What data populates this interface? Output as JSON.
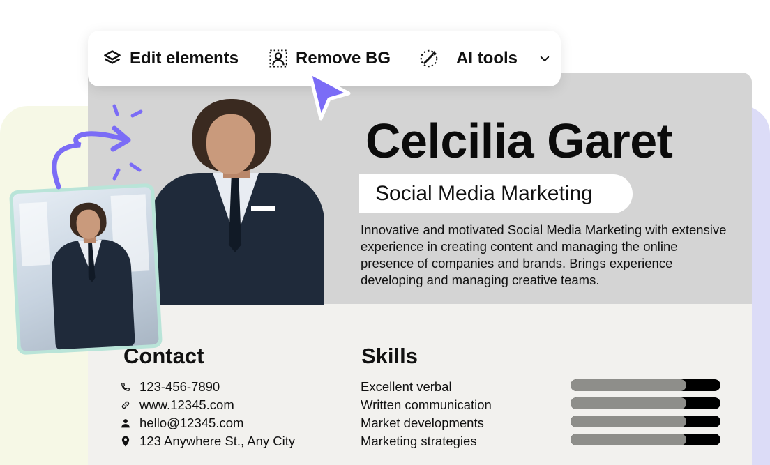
{
  "toolbar": {
    "items": [
      {
        "label": "Edit elements",
        "icon": "layers-icon"
      },
      {
        "label": "Remove BG",
        "icon": "person-remove-bg-icon"
      },
      {
        "label": "AI tools",
        "icon": "magic-wand-icon"
      }
    ],
    "dropdown_icon": "chevron-down-icon"
  },
  "resume": {
    "name": "Celcilia Garet",
    "role": "Social Media Marketing",
    "summary": "Innovative and motivated Social Media Marketing with extensive experience in creating content and managing the online presence of companies and brands. Brings experience developing and managing creative teams.",
    "contact_title": "Contact",
    "contact": [
      {
        "icon": "phone-icon",
        "text": "123-456-7890"
      },
      {
        "icon": "link-icon",
        "text": "www.12345.com"
      },
      {
        "icon": "user-icon",
        "text": "hello@12345.com"
      },
      {
        "icon": "location-pin-icon",
        "text": "123 Anywhere St., Any City"
      }
    ],
    "skills_title": "Skills",
    "skills": [
      {
        "label": "Excellent verbal",
        "level": 0.77
      },
      {
        "label": "Written communication",
        "level": 0.77
      },
      {
        "label": "Market developments",
        "level": 0.77
      },
      {
        "label": "Marketing strategies",
        "level": 0.77
      }
    ]
  },
  "colors": {
    "accent": "#7b6cf6",
    "card_top": "#d4d4d4",
    "card_bottom": "#f2f1ee",
    "bar_fill": "#8e8e8a",
    "bar_track": "#000000"
  }
}
